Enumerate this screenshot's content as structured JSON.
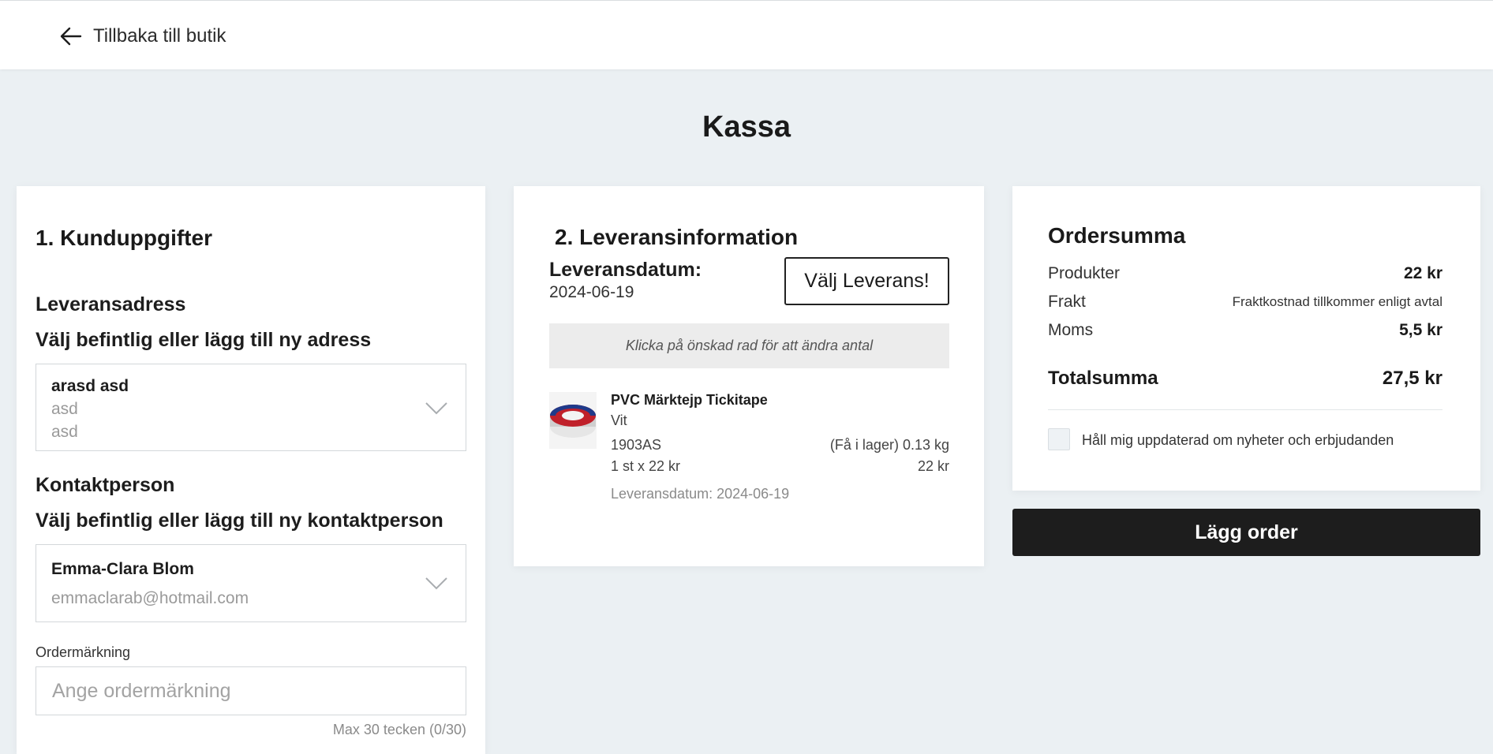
{
  "header": {
    "back_label": "Tillbaka till butik"
  },
  "page": {
    "title": "Kassa"
  },
  "customer": {
    "section_title": "1. Kunduppgifter",
    "address_heading": "Leveransadress",
    "address_prompt": "Välj befintlig eller lägg till ny adress",
    "address_selected": {
      "name": "arasd asd",
      "line1": "asd",
      "line2": "asd"
    },
    "contact_heading": "Kontaktperson",
    "contact_prompt": "Välj befintlig eller lägg till ny kontaktperson",
    "contact_selected": {
      "name": "Emma-Clara Blom",
      "email": "emmaclarab@hotmail.com"
    },
    "order_marking_label": "Ordermärkning",
    "order_marking_placeholder": "Ange ordermärkning",
    "order_marking_value": "",
    "order_marking_hint": "Max 30 tecken (0/30)"
  },
  "delivery": {
    "section_title": "2. Leveransinformation",
    "date_label": "Leveransdatum:",
    "date_value": "2024-06-19",
    "choose_button": "Välj Leverans!",
    "info_text": "Klicka på önskad rad för att ändra antal",
    "items": [
      {
        "name": "PVC Märktejp Tickitape",
        "variant": "Vit",
        "sku": "1903AS",
        "stock_weight": "(Få i lager) 0.13 kg",
        "qty_price": "1 st x 22 kr",
        "line_total": "22 kr",
        "delivery_date": "Leveransdatum: 2024-06-19"
      }
    ]
  },
  "summary": {
    "title": "Ordersumma",
    "rows": [
      {
        "label": "Produkter",
        "value": "22 kr"
      },
      {
        "label": "Frakt",
        "value": "Fraktkostnad tillkommer enligt avtal"
      },
      {
        "label": "Moms",
        "value": "5,5 kr"
      }
    ],
    "total_label": "Totalsumma",
    "total_value": "27,5 kr",
    "newsletter_label": "Håll mig uppdaterad om nyheter och erbjudanden",
    "newsletter_checked": false,
    "place_order_button": "Lägg order"
  },
  "icons": {
    "back": "arrow-left-icon",
    "dropdown": "chevron-down-icon"
  },
  "colors": {
    "page_background": "#ebf0f3",
    "card_background": "#ffffff",
    "primary_button": "#1d1d1d",
    "muted_text": "#9a9a9a",
    "info_bar": "#ececec"
  }
}
